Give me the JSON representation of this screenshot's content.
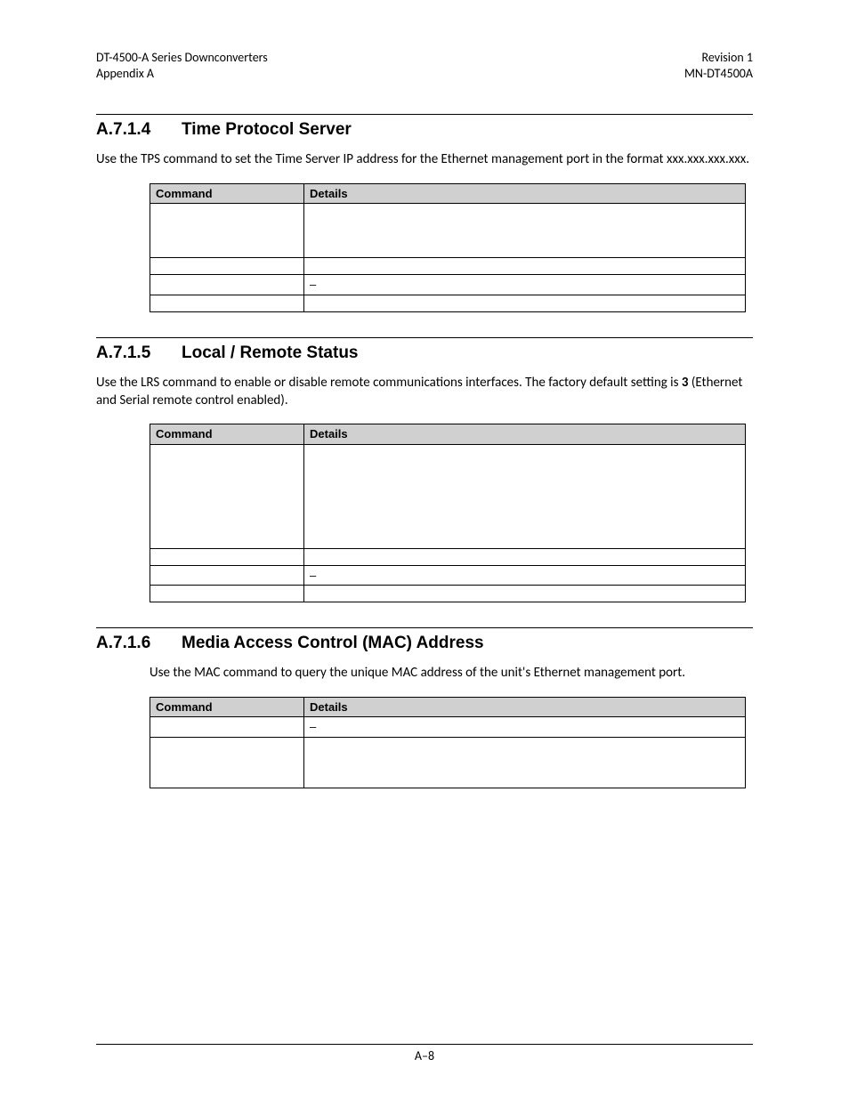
{
  "header": {
    "left": "DT-4500-A Series Downconverters\nAppendix A",
    "right": "Revision 1\nMN-DT4500A"
  },
  "sections": {
    "s1": {
      "num": "A.7.1.4",
      "title": "Time Protocol Server",
      "para": "Use the TPS command to set the Time Server IP address for the Ethernet management port in the format xxx.xxx.xxx.xxx."
    },
    "s2": {
      "num": "A.7.1.5",
      "title": "Local / Remote Status",
      "para_a": "Use the LRS command to enable or disable remote communications interfaces. The factory default setting is ",
      "para_bold": "3",
      "para_b": " (Ethernet and Serial remote control enabled)."
    },
    "s3": {
      "num": "A.7.1.6",
      "title": "Media Access Control (MAC) Address",
      "para": "Use the MAC command to query the unique MAC address of the unit's Ethernet management port."
    }
  },
  "table_headers": {
    "command": "Command",
    "details": "Details"
  },
  "dash": "–",
  "footer": {
    "page": "A–8"
  }
}
